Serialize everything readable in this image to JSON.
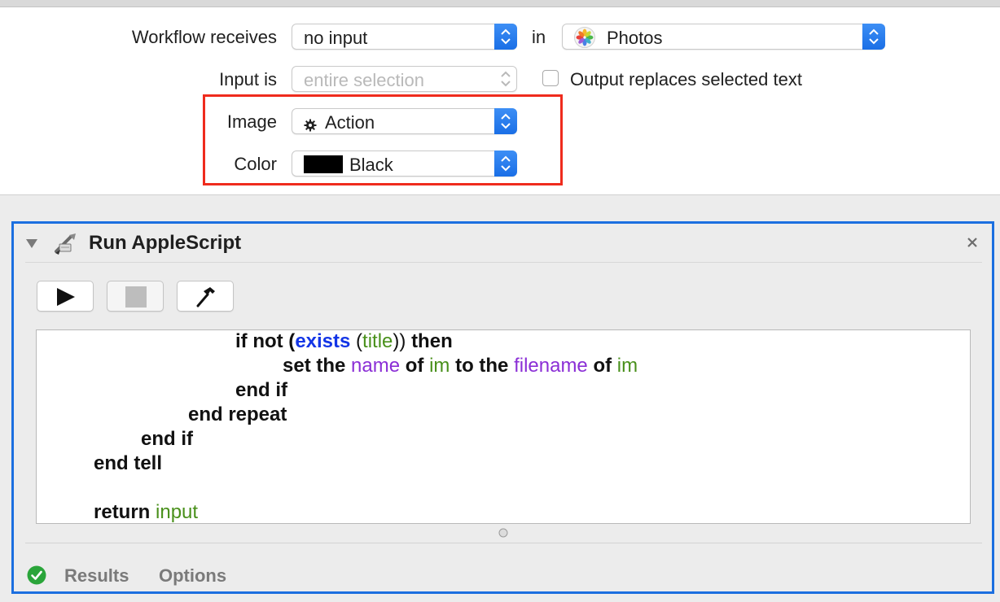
{
  "settings": {
    "workflow_receives_label": "Workflow receives",
    "workflow_receives_value": "no input",
    "in_label": "in",
    "app_value": "Photos",
    "input_is_label": "Input is",
    "input_is_value": "entire selection",
    "output_replaces_label": "Output replaces selected text",
    "output_replaces_checked": false,
    "image_label": "Image",
    "image_value": "Action",
    "color_label": "Color",
    "color_value": "Black",
    "color_swatch": "#000000",
    "highlight_color": "#ef2b1d"
  },
  "action": {
    "title": "Run AppleScript",
    "accent_color": "#1b6fe0",
    "toolbar": {
      "run_icon": "play-icon",
      "stop_icon": "stop-icon",
      "compile_icon": "hammer-icon"
    },
    "code_lines": [
      {
        "indent": 4,
        "segments": [
          {
            "t": "if not (",
            "c": "kw"
          },
          {
            "t": "exists",
            "c": "blue"
          },
          {
            "t": " (",
            "c": "plain"
          },
          {
            "t": "title",
            "c": "green"
          },
          {
            "t": ")) ",
            "c": "plain"
          },
          {
            "t": "then",
            "c": "kw"
          }
        ]
      },
      {
        "indent": 5,
        "segments": [
          {
            "t": "set the ",
            "c": "kw"
          },
          {
            "t": "name",
            "c": "purple"
          },
          {
            "t": " of ",
            "c": "kw"
          },
          {
            "t": "im",
            "c": "green"
          },
          {
            "t": " to the ",
            "c": "kw"
          },
          {
            "t": "filename",
            "c": "purple"
          },
          {
            "t": " of ",
            "c": "kw"
          },
          {
            "t": "im",
            "c": "green"
          }
        ]
      },
      {
        "indent": 4,
        "segments": [
          {
            "t": "end if",
            "c": "kw"
          }
        ]
      },
      {
        "indent": 3,
        "segments": [
          {
            "t": "end repeat",
            "c": "kw"
          }
        ]
      },
      {
        "indent": 2,
        "segments": [
          {
            "t": "end if",
            "c": "kw"
          }
        ]
      },
      {
        "indent": 1,
        "segments": [
          {
            "t": "end tell",
            "c": "kw"
          }
        ]
      },
      {
        "indent": 1,
        "segments": []
      },
      {
        "indent": 1,
        "segments": [
          {
            "t": "return ",
            "c": "kw"
          },
          {
            "t": "input",
            "c": "green"
          }
        ]
      }
    ],
    "footer": {
      "status_color": "#2aa53a",
      "results_label": "Results",
      "options_label": "Options"
    }
  }
}
